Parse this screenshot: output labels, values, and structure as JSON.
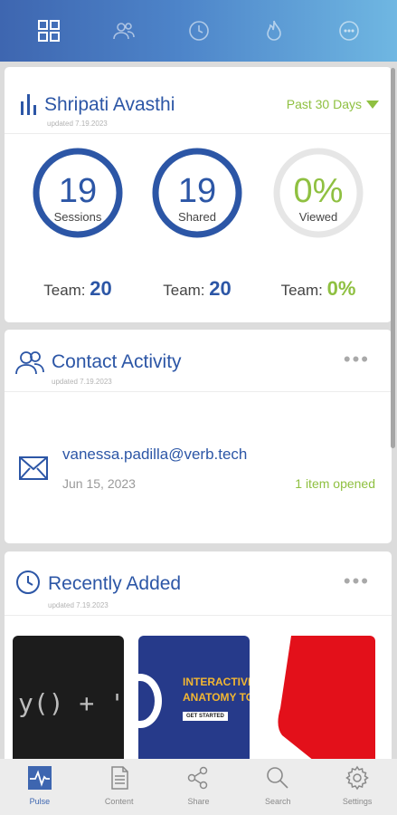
{
  "top_nav": {
    "icons": [
      "grid-icon",
      "people-icon",
      "clock-icon",
      "flame-icon",
      "chat-icon"
    ]
  },
  "summary": {
    "user_name": "Shripati Avasthi",
    "updated": "updated 7.19.2023",
    "range": "Past 30 Days",
    "stats": [
      {
        "value": "19",
        "label": "Sessions",
        "team_prefix": "Team:",
        "team_value": "20",
        "ring_fraction": 1.0
      },
      {
        "value": "19",
        "label": "Shared",
        "team_prefix": "Team:",
        "team_value": "20",
        "ring_fraction": 1.0
      },
      {
        "value": "0%",
        "label": "Viewed",
        "team_prefix": "Team:",
        "team_value": "0%",
        "ring_fraction": 0.0
      }
    ]
  },
  "contact_activity": {
    "title": "Contact Activity",
    "updated": "updated 7.19.2023",
    "more": "•••",
    "item": {
      "email": "vanessa.padilla@verb.tech",
      "date": "Jun 15, 2023",
      "status": "1 item opened"
    }
  },
  "recently_added": {
    "title": "Recently Added",
    "updated": "updated 7.19.2023",
    "more": "•••",
    "thumbs": [
      {
        "code_text": "y() + '\\"
      },
      {
        "line1": "INTERACTIVE",
        "line2": "ANATOMY TOO",
        "button": "GET STARTED"
      },
      {}
    ]
  },
  "bottom_nav": {
    "items": [
      {
        "label": "Pulse",
        "icon": "pulse-icon",
        "active": true
      },
      {
        "label": "Content",
        "icon": "document-icon",
        "active": false
      },
      {
        "label": "Share",
        "icon": "share-icon",
        "active": false
      },
      {
        "label": "Search",
        "icon": "search-icon",
        "active": false
      },
      {
        "label": "Settings",
        "icon": "gear-icon",
        "active": false
      }
    ]
  },
  "colors": {
    "brand_blue": "#2c56a6",
    "accent_green": "#8fc041",
    "ring_gray": "#e6e6e6"
  }
}
